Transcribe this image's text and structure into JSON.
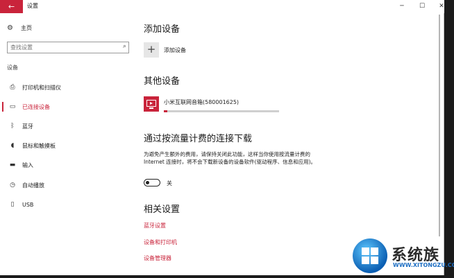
{
  "window": {
    "title": "设置",
    "back_glyph": "←",
    "minimize_glyph": "─",
    "maximize_glyph": "☐",
    "close_glyph": "✕"
  },
  "sidebar": {
    "home_label": "主页",
    "search_placeholder": "查找设置",
    "section_label": "设备",
    "items": [
      {
        "label": "打印机和扫描仪",
        "icon": "printer-icon",
        "active": false
      },
      {
        "label": "已连接设备",
        "icon": "connected-devices-icon",
        "active": true
      },
      {
        "label": "蓝牙",
        "icon": "bluetooth-icon",
        "active": false
      },
      {
        "label": "鼠标和触摸板",
        "icon": "mouse-icon",
        "active": false
      },
      {
        "label": "输入",
        "icon": "keyboard-icon",
        "active": false
      },
      {
        "label": "自动播放",
        "icon": "autoplay-icon",
        "active": false
      },
      {
        "label": "USB",
        "icon": "usb-icon",
        "active": false
      }
    ]
  },
  "main": {
    "add_section_title": "添加设备",
    "add_device_label": "添加设备",
    "other_section_title": "其他设备",
    "device_name": "小米互联网音箱(580001625)",
    "device_progress_percent": 3,
    "metered_title": "通过按流量计费的连接下载",
    "metered_description": "为避免产生额外的费用，请保持关闭此功能，这样当你使用按流量计费的 Internet 连接时，将不会下载新设备的设备软件(驱动程序、信息和应用)。",
    "toggle_state_label": "关",
    "related_title": "相关设置",
    "links": [
      "蓝牙设置",
      "设备和打印机",
      "设备管理器"
    ]
  },
  "watermark": {
    "brand": "系统族",
    "url": "WWW.XITONGZU.COM"
  },
  "colors": {
    "accent": "#c9243b",
    "logo_blue": "#0b5fb3"
  }
}
